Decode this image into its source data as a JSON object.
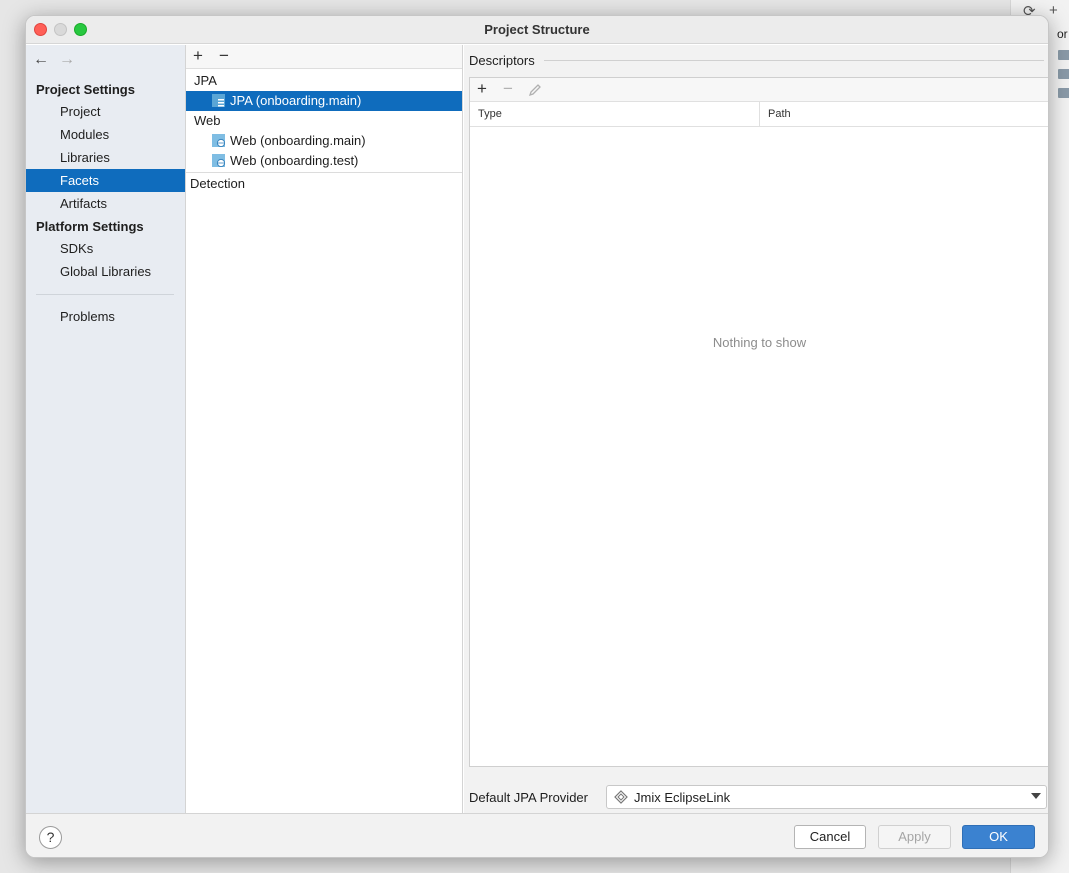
{
  "window": {
    "title": "Project Structure"
  },
  "sidebar": {
    "project_settings_title": "Project Settings",
    "project_items": [
      {
        "label": "Project"
      },
      {
        "label": "Modules"
      },
      {
        "label": "Libraries"
      },
      {
        "label": "Facets",
        "selected": true
      },
      {
        "label": "Artifacts"
      }
    ],
    "platform_settings_title": "Platform Settings",
    "platform_items": [
      {
        "label": "SDKs"
      },
      {
        "label": "Global Libraries"
      }
    ],
    "problems_label": "Problems"
  },
  "facets": {
    "add_label": "+",
    "remove_label": "−",
    "groups": [
      {
        "label": "JPA",
        "children": [
          {
            "label": "JPA (onboarding.main)",
            "selected": true
          }
        ]
      },
      {
        "label": "Web",
        "children": [
          {
            "label": "Web (onboarding.main)"
          },
          {
            "label": "Web (onboarding.test)"
          }
        ]
      }
    ],
    "detection_label": "Detection"
  },
  "descriptors": {
    "section_label": "Descriptors",
    "add_label": "+",
    "remove_label": "−",
    "columns": [
      "Type",
      "Path"
    ],
    "empty_text": "Nothing to show"
  },
  "provider": {
    "label": "Default JPA Provider",
    "value": "Jmix EclipseLink"
  },
  "buttons": {
    "help": "?",
    "cancel": "Cancel",
    "apply": "Apply",
    "ok": "OK"
  },
  "background_ide": {
    "row_text": "or"
  },
  "colors": {
    "accent": "#0f6cbd",
    "ok_button": "#3b82d0"
  }
}
